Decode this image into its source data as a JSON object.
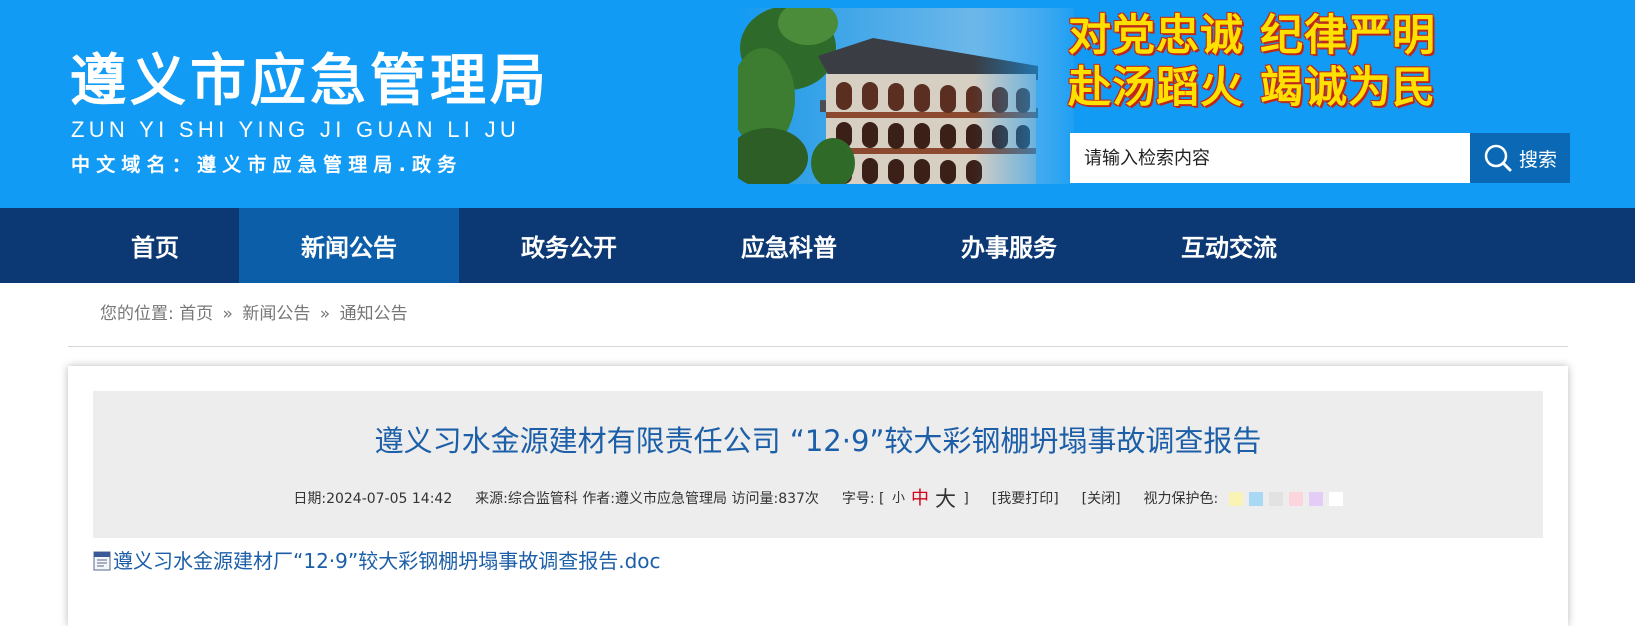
{
  "header": {
    "site_title": "遵义市应急管理局",
    "site_pinyin": "ZUN YI SHI YING JI GUAN LI JU",
    "domain_line": "中文域名：遵义市应急管理局.政务",
    "slogan_line1": "对党忠诚 纪律严明",
    "slogan_line2": "赴汤蹈火 竭诚为民"
  },
  "search": {
    "placeholder": "请输入检索内容",
    "button_label": "搜索"
  },
  "nav": {
    "items": [
      {
        "label": "首页"
      },
      {
        "label": "新闻公告"
      },
      {
        "label": "政务公开"
      },
      {
        "label": "应急科普"
      },
      {
        "label": "办事服务"
      },
      {
        "label": "互动交流"
      }
    ],
    "active_index": 1
  },
  "breadcrumb": {
    "prefix": "您的位置:",
    "items": [
      "首页",
      "新闻公告",
      "通知公告"
    ],
    "separator": "»"
  },
  "article": {
    "title": "遵义习水金源建材有限责任公司 “12·9”较大彩钢棚坍塌事故调查报告",
    "date_label": "日期:",
    "date": "2024-07-05 14:42",
    "source_label": "来源:",
    "source": "综合监管科",
    "author_label": "作者:",
    "author": "遵义市应急管理局",
    "visits_label": "访问量:",
    "visits": "837次",
    "font_size_label": "字号:",
    "font_bracket_open": "[",
    "font_bracket_close": "]",
    "font_small": "小",
    "font_mid": "中",
    "font_big": "大",
    "print_label": "[我要打印]",
    "close_label": "[关闭]",
    "eye_color_label": "视力保护色:",
    "eye_colors": [
      "#faf4b4",
      "#a9d8f5",
      "#e2e2e2",
      "#fbd4dc",
      "#e3cdf7",
      "#ffffff"
    ],
    "attachment": "遵义习水金源建材厂“12·9”较大彩钢棚坍塌事故调查报告.doc"
  },
  "colors": {
    "header_bg": "#129bf4",
    "nav_bg": "#0c3873",
    "nav_active": "#0c5ea8",
    "title_color": "#1c5fa8",
    "slogan_color": "#ffe100"
  }
}
